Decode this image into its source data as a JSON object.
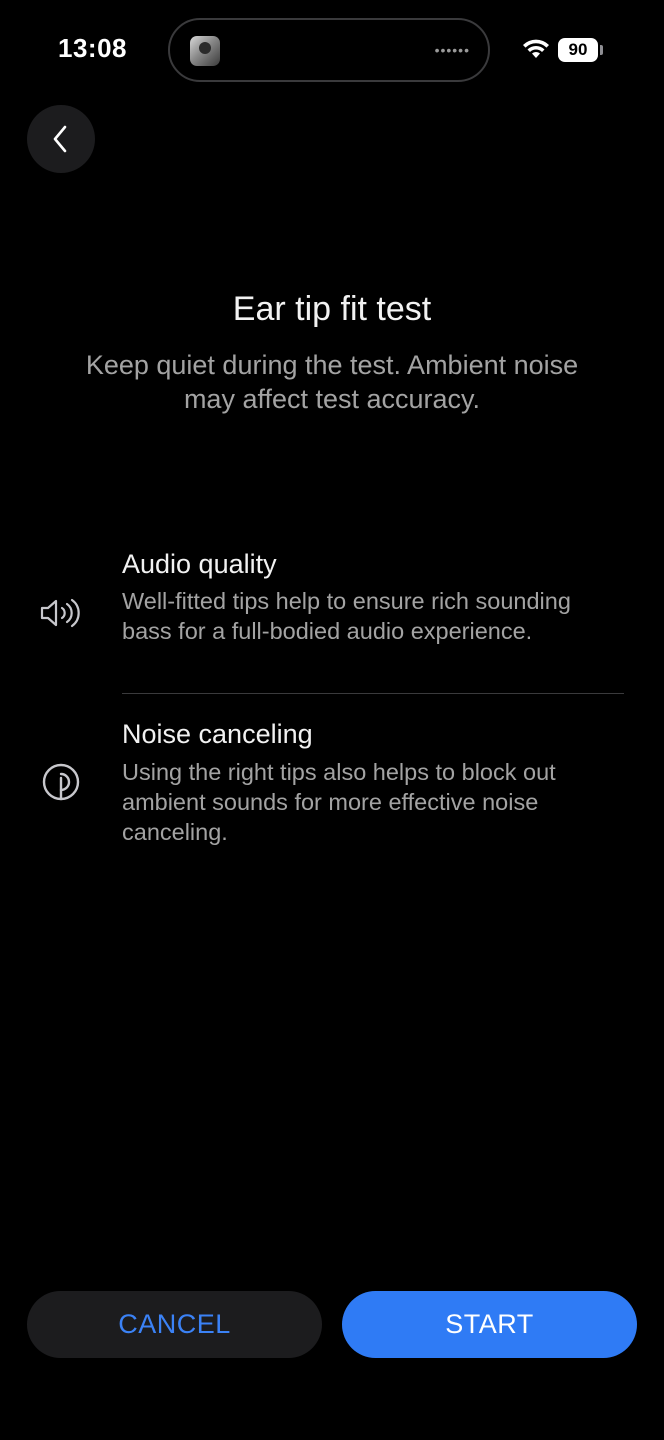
{
  "status_bar": {
    "time": "13:08",
    "battery_level": "90",
    "island_indicator": "••••••"
  },
  "header": {
    "back_icon": "chevron-left-icon"
  },
  "content": {
    "title": "Ear tip fit test",
    "subtitle": "Keep quiet during the test. Ambient noise may affect test accuracy."
  },
  "features": [
    {
      "icon": "speaker-volume-icon",
      "title": "Audio quality",
      "description": "Well-fitted tips help to ensure rich sounding bass for a full-bodied audio experience."
    },
    {
      "icon": "noise-canceling-icon",
      "title": "Noise canceling",
      "description": "Using the right tips also helps to block out ambient sounds for more effective noise canceling."
    }
  ],
  "actions": {
    "cancel_label": "CANCEL",
    "start_label": "START"
  },
  "colors": {
    "background": "#000000",
    "accent": "#2f7bf5",
    "cancel_text": "#3b82f6"
  }
}
